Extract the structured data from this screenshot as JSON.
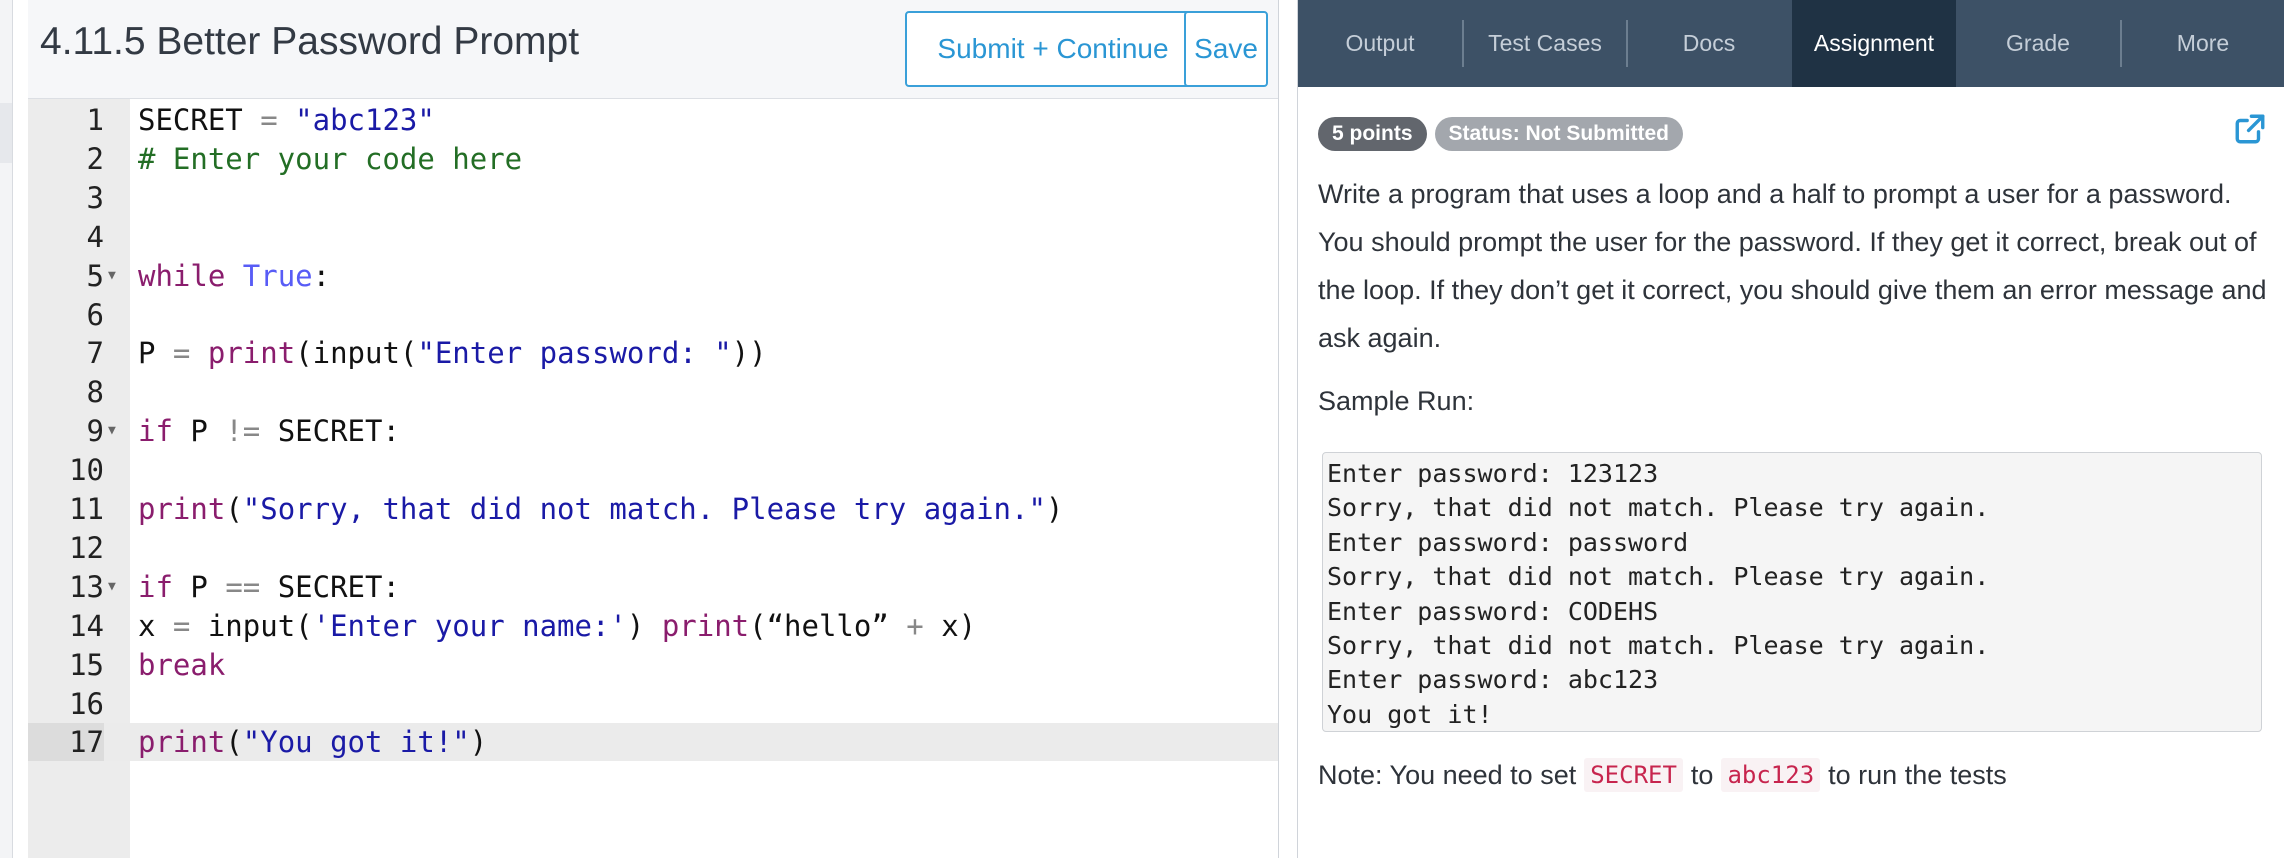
{
  "editor": {
    "title": "4.11.5 Better Password Prompt",
    "submit_label": "Submit + Continue",
    "save_label": "Save",
    "active_line": 17,
    "lines": [
      {
        "n": "1",
        "fold": false,
        "tokens": [
          [
            "plain",
            "SECRET "
          ],
          [
            "op",
            "="
          ],
          [
            "plain",
            " "
          ],
          [
            "str",
            "\"abc123\""
          ]
        ]
      },
      {
        "n": "2",
        "fold": false,
        "tokens": [
          [
            "com",
            "# Enter your code here"
          ]
        ]
      },
      {
        "n": "3",
        "fold": false,
        "tokens": []
      },
      {
        "n": "4",
        "fold": false,
        "tokens": []
      },
      {
        "n": "5",
        "fold": true,
        "tokens": [
          [
            "kw",
            "while"
          ],
          [
            "plain",
            " "
          ],
          [
            "const",
            "True"
          ],
          [
            "plain",
            ":"
          ]
        ]
      },
      {
        "n": "6",
        "fold": false,
        "tokens": []
      },
      {
        "n": "7",
        "fold": false,
        "tokens": [
          [
            "plain",
            "P "
          ],
          [
            "op",
            "="
          ],
          [
            "plain",
            " "
          ],
          [
            "fn",
            "print"
          ],
          [
            "plain",
            "(input("
          ],
          [
            "str",
            "\"Enter password: \""
          ],
          [
            "plain",
            "))"
          ]
        ]
      },
      {
        "n": "8",
        "fold": false,
        "tokens": []
      },
      {
        "n": "9",
        "fold": true,
        "tokens": [
          [
            "kw",
            "if"
          ],
          [
            "plain",
            " P "
          ],
          [
            "op",
            "!="
          ],
          [
            "plain",
            " SECRET:"
          ]
        ]
      },
      {
        "n": "10",
        "fold": false,
        "tokens": []
      },
      {
        "n": "11",
        "fold": false,
        "tokens": [
          [
            "fn",
            "print"
          ],
          [
            "plain",
            "("
          ],
          [
            "str",
            "\"Sorry, that did not match. Please try again.\""
          ],
          [
            "plain",
            ")"
          ]
        ]
      },
      {
        "n": "12",
        "fold": false,
        "tokens": []
      },
      {
        "n": "13",
        "fold": true,
        "tokens": [
          [
            "kw",
            "if"
          ],
          [
            "plain",
            " P "
          ],
          [
            "op",
            "=="
          ],
          [
            "plain",
            " SECRET:"
          ]
        ]
      },
      {
        "n": "14",
        "fold": false,
        "tokens": [
          [
            "plain",
            "x "
          ],
          [
            "op",
            "="
          ],
          [
            "plain",
            " input("
          ],
          [
            "str",
            "'Enter your name:'"
          ],
          [
            "plain",
            ") "
          ],
          [
            "fn",
            "print"
          ],
          [
            "plain",
            "(“hello” "
          ],
          [
            "op",
            "+"
          ],
          [
            "plain",
            " x)"
          ]
        ]
      },
      {
        "n": "15",
        "fold": false,
        "tokens": [
          [
            "kw",
            "break"
          ]
        ]
      },
      {
        "n": "16",
        "fold": false,
        "tokens": []
      },
      {
        "n": "17",
        "fold": false,
        "tokens": [
          [
            "fn",
            "print"
          ],
          [
            "plain",
            "("
          ],
          [
            "str",
            "\"You got it!\""
          ],
          [
            "plain",
            ")"
          ]
        ]
      }
    ]
  },
  "tabs": [
    {
      "label": "Output",
      "active": false
    },
    {
      "label": "Test Cases",
      "active": false
    },
    {
      "label": "Docs",
      "active": false
    },
    {
      "label": "Assignment",
      "active": true
    },
    {
      "label": "Grade",
      "active": false
    },
    {
      "label": "More",
      "active": false
    }
  ],
  "assignment": {
    "points_badge": "5 points",
    "status_badge": "Status: Not Submitted",
    "description": "Write a program that uses a loop and a half to prompt a user for a password. You should prompt the user for the password. If they get it correct, break out of the loop. If they don’t get it correct, you should give them an error message and ask again.",
    "sample_label": "Sample Run:",
    "sample_lines": [
      "Enter password: 123123",
      "Sorry, that did not match. Please try again.",
      "Enter password: password",
      "Sorry, that did not match. Please try again.",
      "Enter password: CODEHS",
      "Sorry, that did not match. Please try again.",
      "Enter password: abc123",
      "You got it!"
    ],
    "note_prefix": "Note: You need to set",
    "note_code1": "SECRET",
    "note_mid": "to",
    "note_code2": "abc123",
    "note_suffix": "to run the tests"
  },
  "colors": {
    "accent": "#2a96d4",
    "tabbar": "#3d5166",
    "tab_active": "#1f3244",
    "keyword": "#8a1d6d",
    "string": "#1a1aa6",
    "comment": "#236e25",
    "constant": "#585cf6"
  },
  "icons": {
    "external_link": "external-link-icon",
    "fold": "fold-arrow-icon"
  }
}
